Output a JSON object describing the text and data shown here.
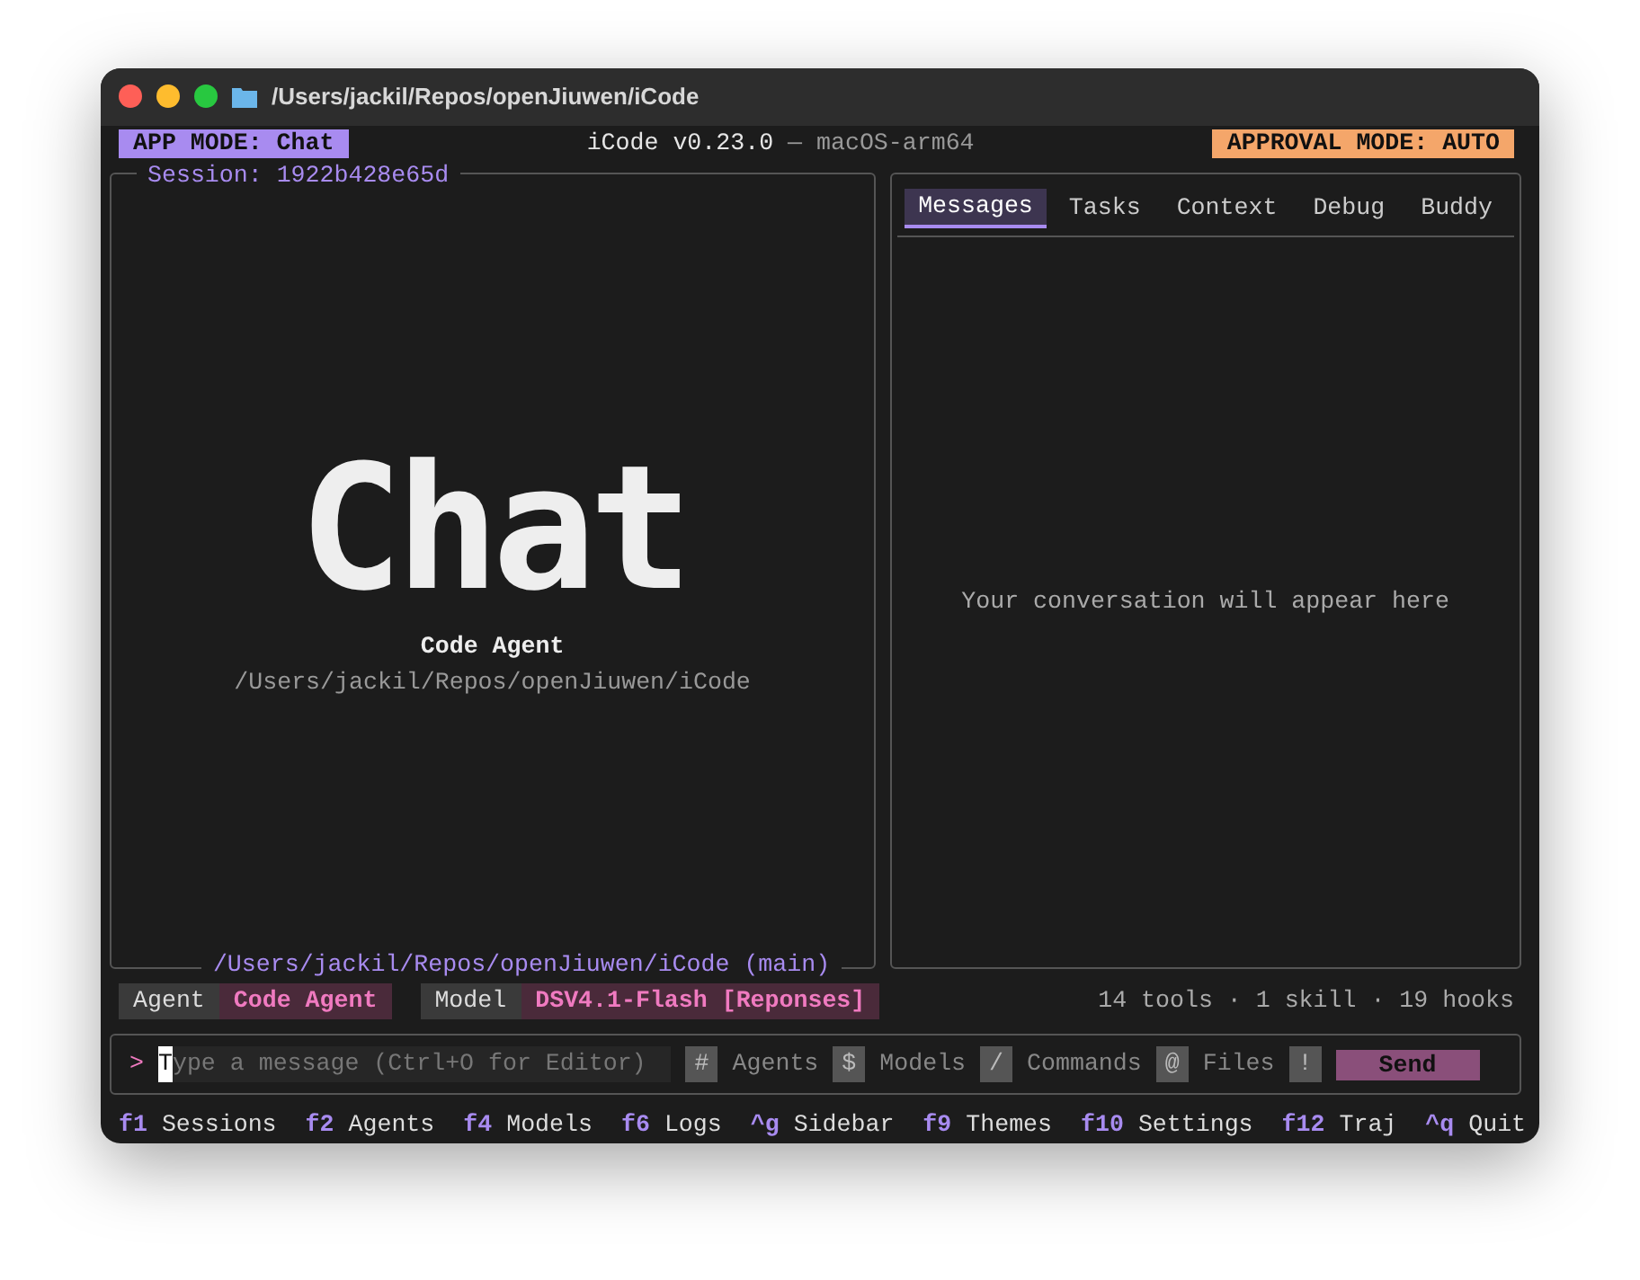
{
  "window": {
    "title": "/Users/jackil/Repos/openJiuwen/iCode"
  },
  "header": {
    "app_mode": "APP MODE: Chat",
    "version": "iCode v0.23.0",
    "platform": "— macOS-arm64",
    "approval_mode": "APPROVAL MODE: AUTO"
  },
  "session_panel": {
    "title": "Session: 1922b428e65d",
    "banner": "Chat",
    "agent_name": "Code Agent",
    "path": "/Users/jackil/Repos/openJiuwen/iCode",
    "footer_path": "/Users/jackil/Repos/openJiuwen/iCode (main)"
  },
  "side_panel": {
    "tabs": [
      {
        "label": "Messages",
        "selected": true
      },
      {
        "label": "Tasks",
        "selected": false
      },
      {
        "label": "Context",
        "selected": false
      },
      {
        "label": "Debug",
        "selected": false
      },
      {
        "label": "Buddy",
        "selected": false
      }
    ],
    "empty_text": "Your conversation will appear here"
  },
  "status": {
    "chips": [
      {
        "label": "Agent",
        "value": "Code Agent"
      },
      {
        "label": "Model",
        "value": "DSV4.1-Flash [Reponses]"
      }
    ],
    "summary": "14 tools · 1 skill · 19 hooks"
  },
  "input": {
    "prompt": ">",
    "cursor_char": "T",
    "placeholder": "ype a message (Ctrl+O for Editor)",
    "shortcuts": [
      {
        "key": "#",
        "label": "Agents"
      },
      {
        "key": "$",
        "label": "Models"
      },
      {
        "key": "/",
        "label": "Commands"
      },
      {
        "key": "@",
        "label": "Files"
      },
      {
        "key": "!"
      }
    ],
    "send": "Send"
  },
  "footer": [
    {
      "key": "f1",
      "label": "Sessions"
    },
    {
      "key": "f2",
      "label": "Agents"
    },
    {
      "key": "f4",
      "label": "Models"
    },
    {
      "key": "f6",
      "label": "Logs"
    },
    {
      "key": "^g",
      "label": "Sidebar"
    },
    {
      "key": "f9",
      "label": "Themes"
    },
    {
      "key": "f10",
      "label": "Settings"
    },
    {
      "key": "f12",
      "label": "Traj"
    },
    {
      "key": "^q",
      "label": "Quit"
    }
  ]
}
